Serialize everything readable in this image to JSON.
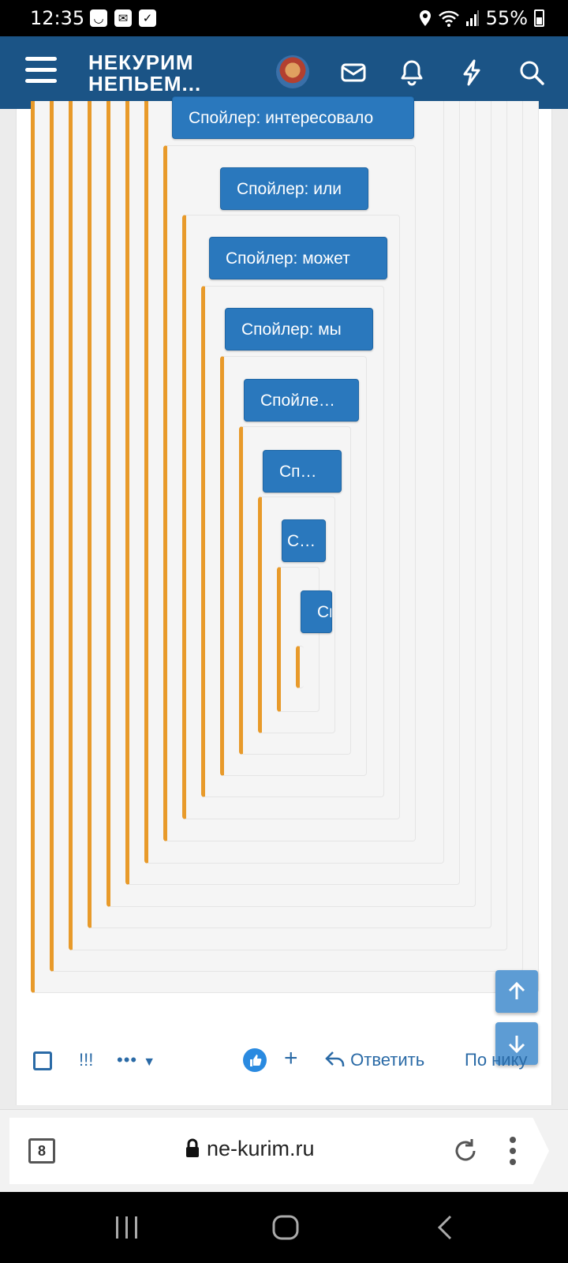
{
  "status_bar": {
    "time": "12:35",
    "battery": "55%"
  },
  "header": {
    "logo_line1": "НЕКУРИМ",
    "logo_line2": "НЕПЬЕМ..."
  },
  "spoilers": [
    {
      "label": "Спойлер: интересовало"
    },
    {
      "label": "Спойлер: или"
    },
    {
      "label": "Спойлер: может"
    },
    {
      "label": "Спойлер: мы"
    },
    {
      "label": "Спойлер: ..."
    },
    {
      "label": "Спойлер: ..."
    },
    {
      "label": "Спойлер: ..."
    },
    {
      "label": "Спойлер: ..."
    }
  ],
  "actions": {
    "exclaim": "!!!",
    "more": "•••",
    "plus": "+",
    "reply": "Ответить",
    "by_nick": "По нику"
  },
  "browser": {
    "tab_count": "8",
    "url": "ne-kurim.ru"
  }
}
